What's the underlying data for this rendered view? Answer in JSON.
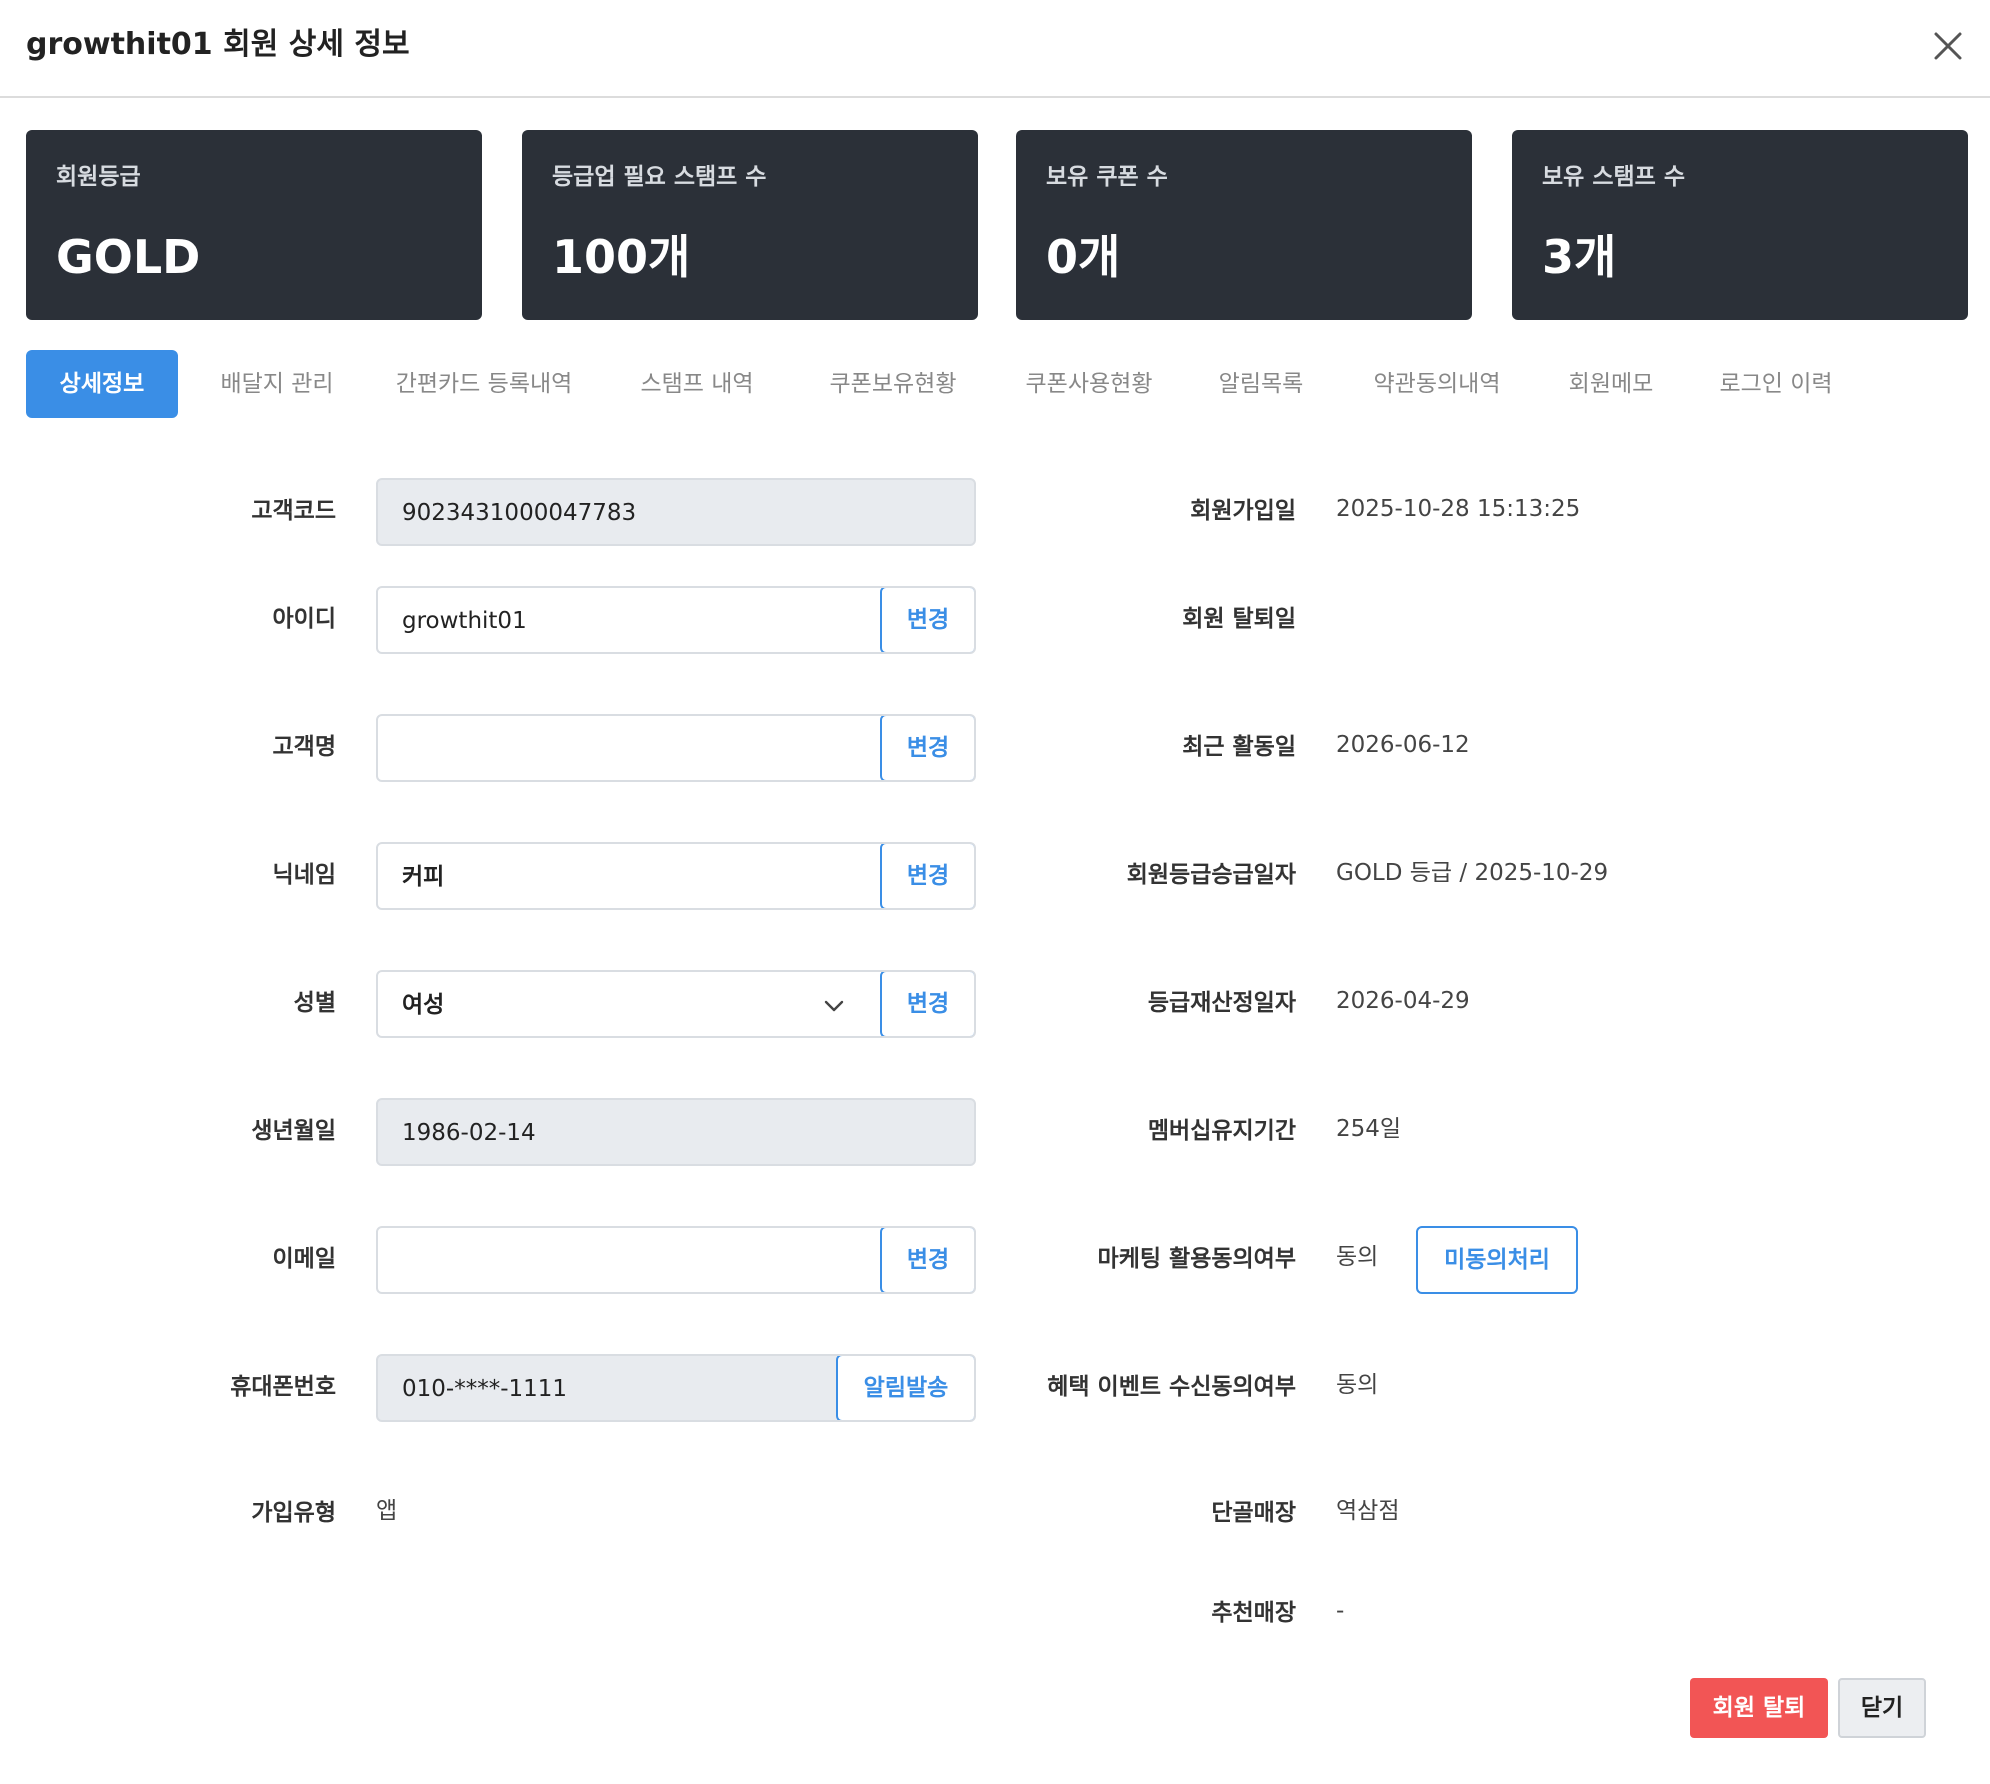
{
  "header": {
    "title": "growthit01 회원 상세 정보"
  },
  "stats": [
    {
      "label": "회원등급",
      "value": "GOLD"
    },
    {
      "label": "등급업 필요 스탬프 수",
      "value": "100개"
    },
    {
      "label": "보유 쿠폰 수",
      "value": "0개"
    },
    {
      "label": "보유 스탬프 수",
      "value": "3개"
    }
  ],
  "tabs": [
    {
      "label": "상세정보",
      "active": true
    },
    {
      "label": "배달지 관리"
    },
    {
      "label": "간편카드 등록내역"
    },
    {
      "label": "스탬프 내역"
    },
    {
      "label": "쿠폰보유현황"
    },
    {
      "label": "쿠폰사용현황"
    },
    {
      "label": "알림목록"
    },
    {
      "label": "약관동의내역"
    },
    {
      "label": "회원메모"
    },
    {
      "label": "로그인 이력"
    }
  ],
  "left_fields": {
    "customer_code": {
      "label": "고객코드",
      "value": "9023431000047783"
    },
    "user_id": {
      "label": "아이디",
      "value": "growthit01",
      "button": "변경"
    },
    "customer_name": {
      "label": "고객명",
      "value": "",
      "button": "변경"
    },
    "nickname": {
      "label": "닉네임",
      "value": "커피",
      "button": "변경"
    },
    "gender": {
      "label": "성별",
      "value": "여성",
      "button": "변경"
    },
    "birthdate": {
      "label": "생년월일",
      "value": "1986-02-14"
    },
    "email": {
      "label": "이메일",
      "value": "",
      "button": "변경"
    },
    "phone": {
      "label": "휴대폰번호",
      "value": "010-****-1111",
      "button": "알림발송"
    },
    "signup_type": {
      "label": "가입유형",
      "value": "앱"
    }
  },
  "right_fields": {
    "join_date": {
      "label": "회원가입일",
      "value": "2025-10-28 15:13:25"
    },
    "withdraw_date": {
      "label": "회원 탈퇴일",
      "value": ""
    },
    "last_active": {
      "label": "최근 활동일",
      "value": "2026-06-12"
    },
    "grade_up_date": {
      "label": "회원등급승급일자",
      "value": "GOLD 등급 / 2025-10-29"
    },
    "grade_recalc_date": {
      "label": "등급재산정일자",
      "value": "2026-04-29"
    },
    "membership_period": {
      "label": "멤버십유지기간",
      "value": "254일"
    },
    "marketing_consent": {
      "label": "마케팅 활용동의여부",
      "value": "동의",
      "button": "미동의처리"
    },
    "benefit_event_consent": {
      "label": "혜택 이벤트 수신동의여부",
      "value": "동의"
    },
    "favorite_store": {
      "label": "단골매장",
      "value": "역삼점"
    },
    "recommend_store": {
      "label": "추천매장",
      "value": "-"
    }
  },
  "footer": {
    "withdraw_button": "회원 탈퇴",
    "close_button": "닫기"
  },
  "colors": {
    "accent": "#3a8ee6",
    "card_bg": "#2b3038",
    "danger": "#f25555"
  },
  "icons": {
    "close": "close-icon",
    "dropdown": "chevron-down-icon"
  }
}
